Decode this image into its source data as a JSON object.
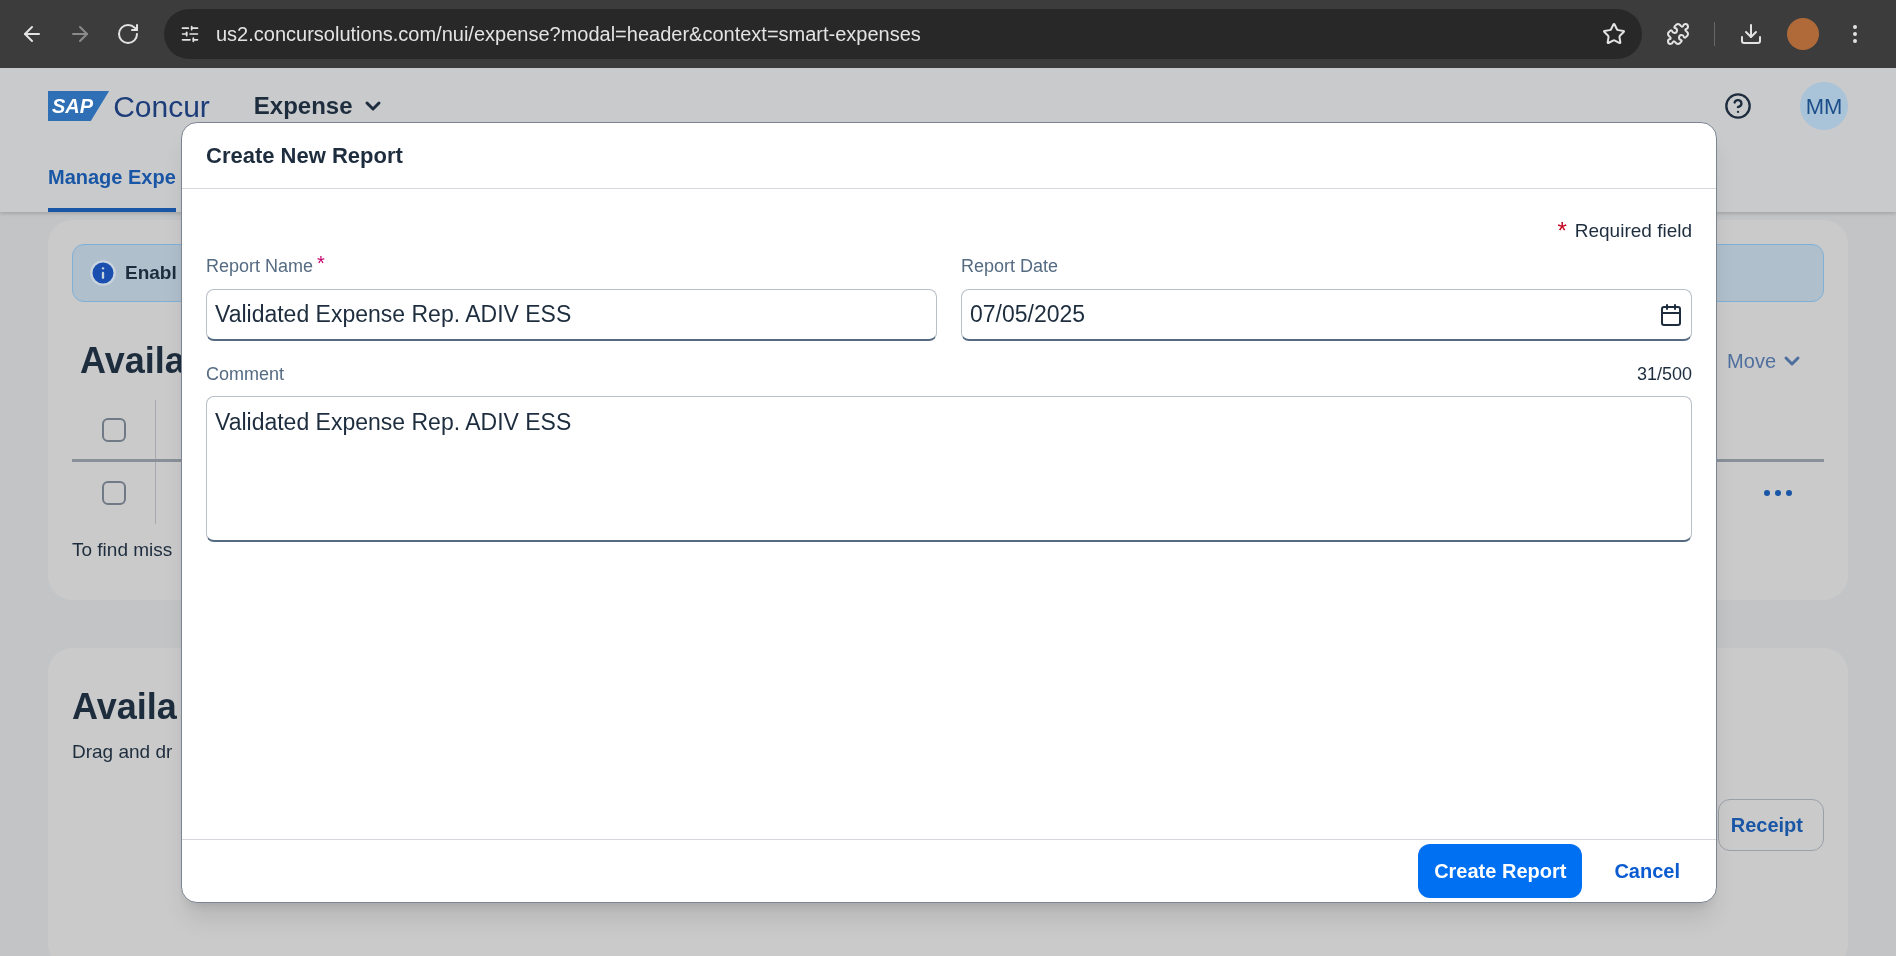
{
  "browser": {
    "url": "us2.concursolutions.com/nui/expense?modal=header&context=smart-expenses"
  },
  "app_header": {
    "logo_mark": "SAP",
    "logo_name": "Concur",
    "module": "Expense",
    "avatar": "MM",
    "tabs": [
      {
        "label": "Manage Expe",
        "selected": true
      }
    ]
  },
  "background": {
    "banner": "Enabl",
    "heading_1": "Availa",
    "table_rows": [
      {
        "checked": false
      },
      {
        "checked": false
      }
    ],
    "footnote": "To find miss",
    "move_menu": "Move",
    "heading_2": "Availa",
    "subtext": "Drag and dr",
    "receipt_button": "Receipt"
  },
  "dialog": {
    "title": "Create New Report",
    "required_mark": "*",
    "required_note": "Required field",
    "fields": [
      {
        "label": "Report Name",
        "required": true,
        "value": "Validated Expense Rep. ADIV ESS",
        "kind": "text"
      },
      {
        "label": "Report Date",
        "required": false,
        "value": "07/05/2025",
        "kind": "date"
      }
    ],
    "comment": {
      "label": "Comment",
      "counter": "31/500",
      "value": "Validated Expense Rep. ADIV ESS"
    },
    "buttons": [
      {
        "label": "Create Report",
        "kind": "primary"
      },
      {
        "label": "Cancel",
        "kind": "link"
      }
    ]
  }
}
